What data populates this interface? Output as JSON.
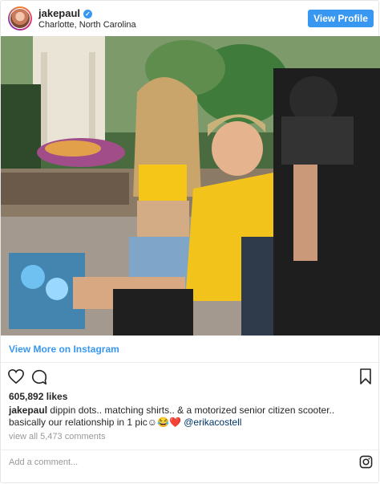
{
  "post": {
    "username": "jakepaul",
    "verified_symbol": "✓",
    "location": "Charlotte, North Carolina",
    "view_profile_label": "View Profile",
    "view_more_label": "View More on Instagram",
    "likes": "605,892 likes",
    "caption_user": "jakepaul",
    "caption_text": " dippin dots.. matching shirts.. & a motorized senior citizen scooter.. basically our relationship in 1 pic☺😂❤️ ",
    "caption_mention": "@erikacostell",
    "view_comments": "view all 5,473 comments",
    "add_comment_placeholder": "Add a comment..."
  },
  "icons": {
    "like": "heart-icon",
    "comment": "comment-icon",
    "save": "bookmark-icon",
    "brand": "instagram-icon"
  },
  "colors": {
    "accent": "#3897f0",
    "text": "#262626",
    "muted": "#999999",
    "mention": "#003569"
  }
}
